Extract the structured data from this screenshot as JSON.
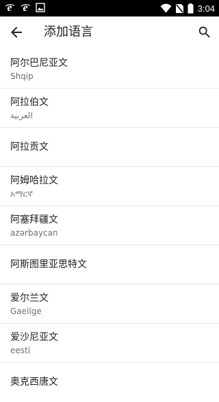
{
  "statusbar": {
    "time": "3:04",
    "left_icons": [
      "ie-icon",
      "ie-icon",
      "image-icon"
    ],
    "right_icons": [
      "wifi-icon",
      "no-sim-icon",
      "battery-icon"
    ]
  },
  "appbar": {
    "title": "添加语言",
    "back_icon": "arrow-back-icon",
    "search_icon": "search-icon"
  },
  "languages": [
    {
      "name": "阿尔巴尼亚文",
      "native": "Shqip"
    },
    {
      "name": "阿拉伯文",
      "native": "العربية"
    },
    {
      "name": "阿拉贡文",
      "native": ""
    },
    {
      "name": "阿姆哈拉文",
      "native": "አማርኛ"
    },
    {
      "name": "阿塞拜疆文",
      "native": "azərbaycan"
    },
    {
      "name": "阿斯图里亚思特文",
      "native": ""
    },
    {
      "name": "爱尔兰文",
      "native": "Gaeilge"
    },
    {
      "name": "爱沙尼亚文",
      "native": "eesti"
    },
    {
      "name": "奥克西唐文",
      "native": ""
    }
  ],
  "colors": {
    "statusbar_bg": "#000000",
    "text_primary": "#212121",
    "text_secondary": "#6f6f6f",
    "divider": "#e6e6e6"
  }
}
